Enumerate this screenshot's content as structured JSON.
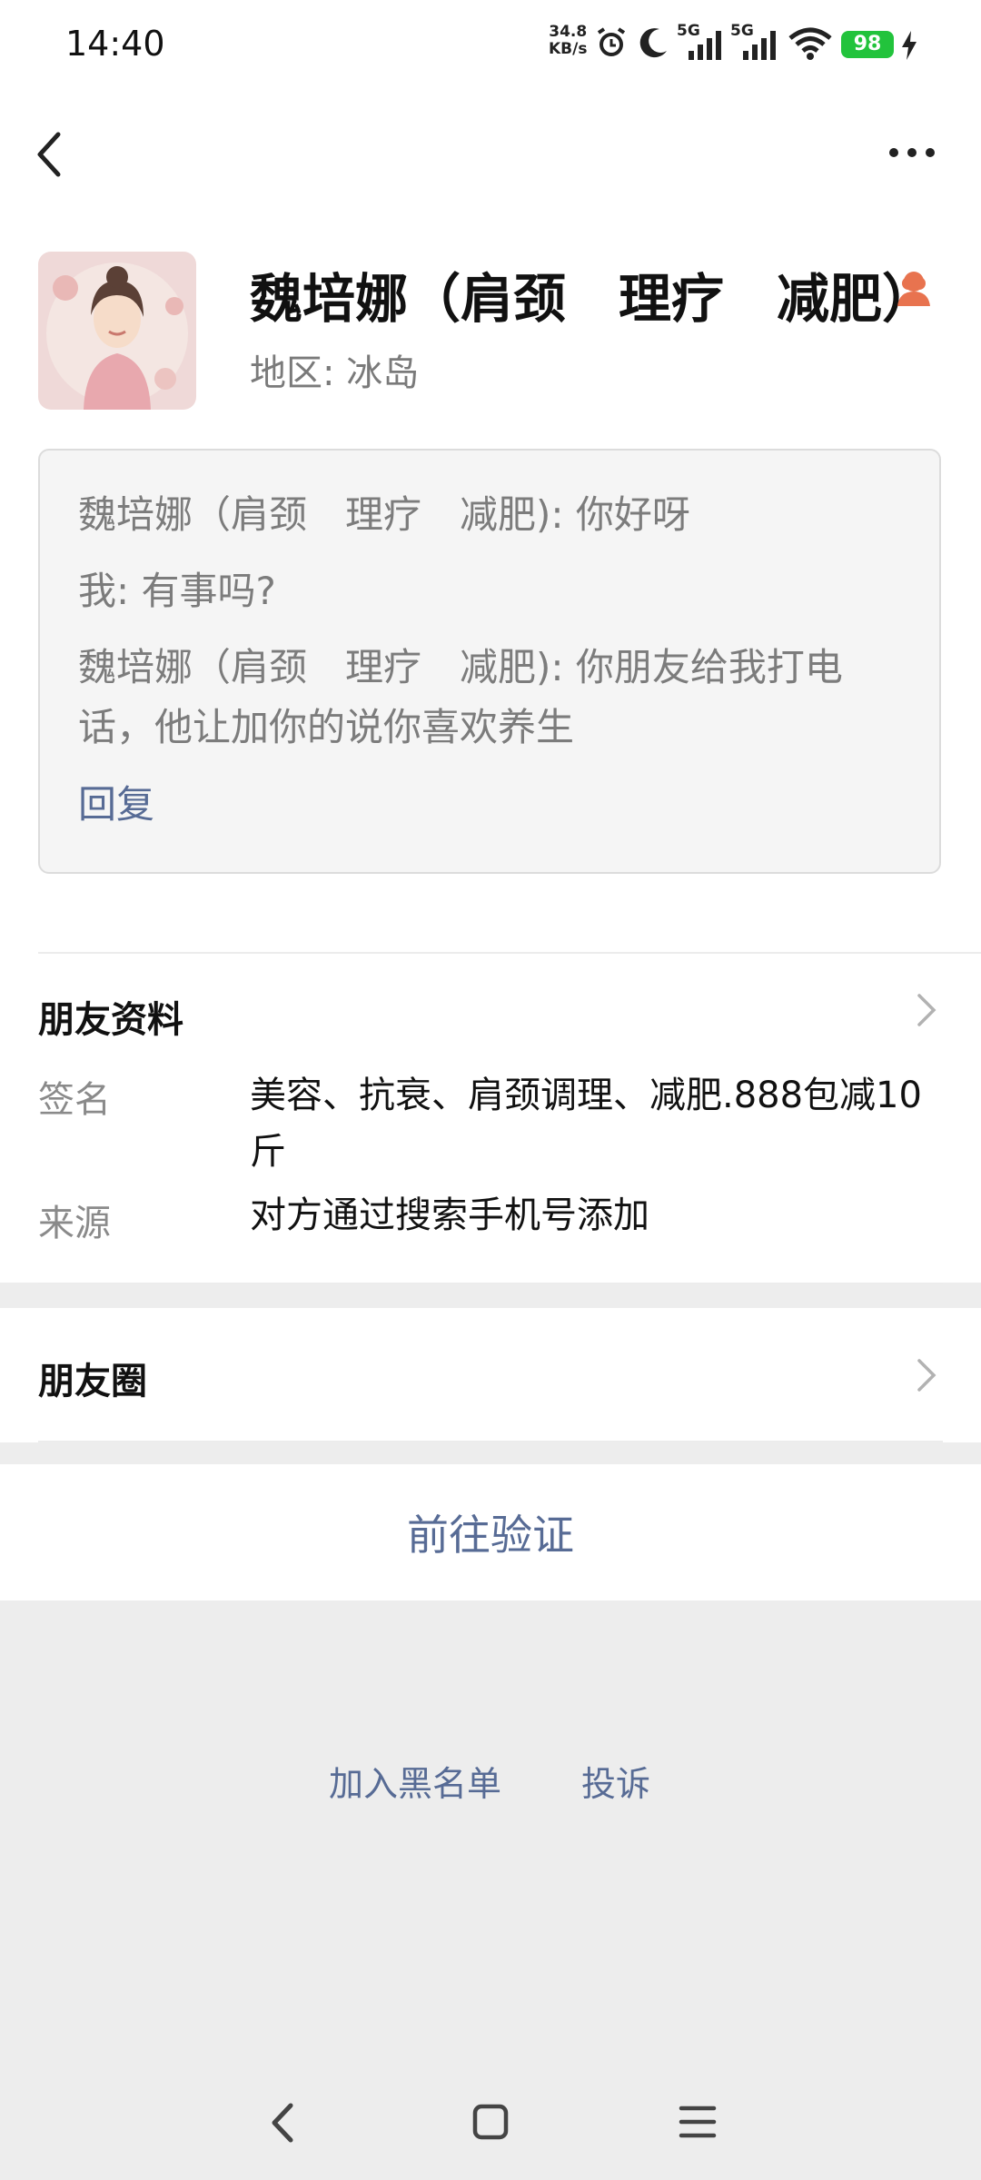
{
  "status_bar": {
    "time": "14:40",
    "net_speed_value": "34.8",
    "net_speed_unit": "KB/s",
    "signal1_label": "5G",
    "signal2_label": "5G",
    "battery": "98",
    "icons": [
      "alarm-icon",
      "moon-icon",
      "signal-icon",
      "wifi-icon",
      "battery-icon",
      "charging-icon"
    ]
  },
  "nav": {
    "back_icon": "back-icon",
    "more_icon": "more-icon"
  },
  "profile": {
    "name": "魏培娜（肩颈　理疗　减肥）",
    "region_label": "地区:",
    "region_value": "冰岛",
    "gender_icon": "female-icon"
  },
  "greeting": {
    "line1": "魏培娜（肩颈　理疗　减肥): 你好呀",
    "line2": "我: 有事吗?",
    "line3a": "魏培娜（肩颈　理疗　减肥): 你朋友给我打电",
    "line3b": "话，他让加你的说你喜欢养生",
    "reply": "回复"
  },
  "friend_info": {
    "title": "朋友资料",
    "signature_label": "签名",
    "signature_value": "美容、抗衰、肩颈调理、减肥.888包减10斤",
    "source_label": "来源",
    "source_value": "对方通过搜索手机号添加"
  },
  "moments": {
    "title": "朋友圈"
  },
  "actions": {
    "verify": "前往验证",
    "blacklist": "加入黑名单",
    "report": "投诉"
  },
  "colors": {
    "link": "#576b95",
    "battery": "#22c33c",
    "gender": "#e8734f"
  }
}
